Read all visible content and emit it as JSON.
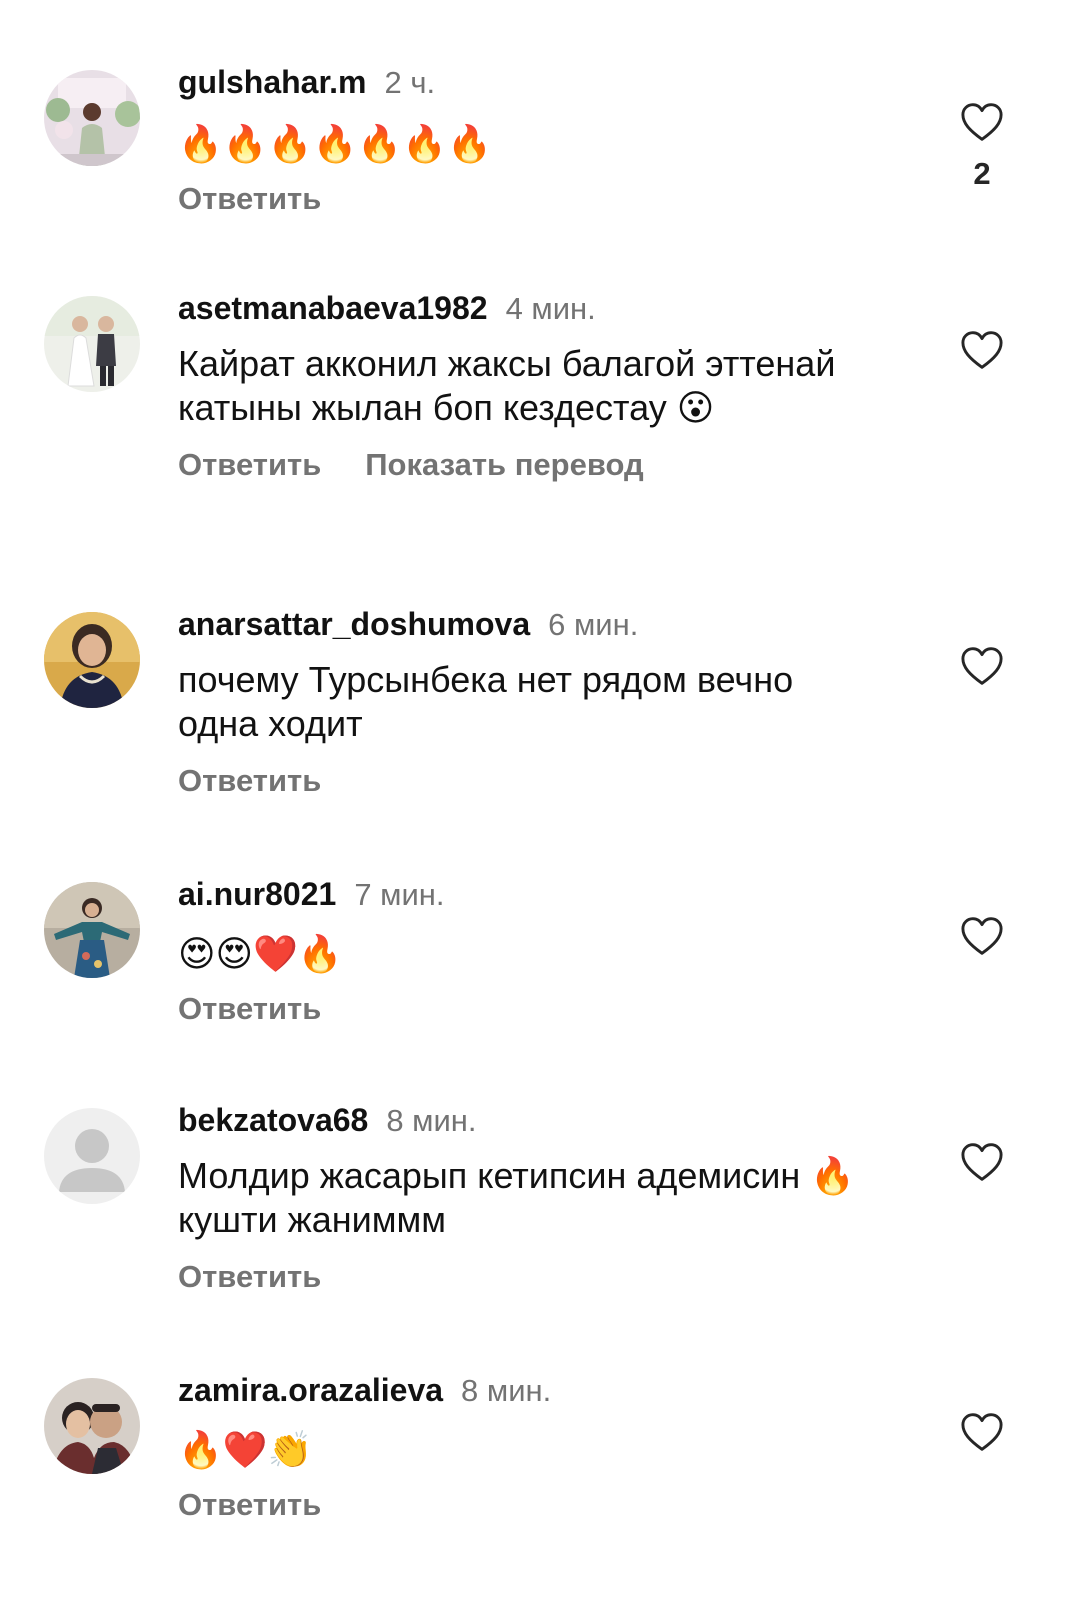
{
  "colors": {
    "text": "#121212",
    "secondary": "#737373",
    "background": "#ffffff"
  },
  "comments": [
    {
      "username": "gulshahar.m",
      "time": "2 ч.",
      "text": "🔥🔥🔥🔥🔥🔥🔥",
      "reply_label": "Ответить",
      "like_count": "2",
      "avatar": "photo-woman-flower-wall"
    },
    {
      "username": "asetmanabaeva1982",
      "time": "4 мин.",
      "text": "Кайрат акконил жаксы балагой эттенай катыны жылан боп кездестау 😮",
      "reply_label": "Ответить",
      "translate_label": "Показать перевод",
      "avatar": "photo-two-children"
    },
    {
      "username": "anarsattar_doshumova",
      "time": "6 мин.",
      "text": "почему Турсынбека нет рядом вечно одна ходит",
      "reply_label": "Ответить",
      "avatar": "photo-woman-portrait"
    },
    {
      "username": "ai.nur8021",
      "time": "7 мин.",
      "text": "😍😍❤️🔥",
      "reply_label": "Ответить",
      "avatar": "photo-woman-dress"
    },
    {
      "username": "bekzatova68",
      "time": "8 мин.",
      "text": "Молдир жасарып кетипсин адемисин 🔥 кушти жаниммм",
      "reply_label": "Ответить",
      "avatar": "default-user-icon"
    },
    {
      "username": "zamira.orazalieva",
      "time": "8 мин.",
      "text": "🔥❤️👏",
      "reply_label": "Ответить",
      "avatar": "photo-couple"
    }
  ]
}
